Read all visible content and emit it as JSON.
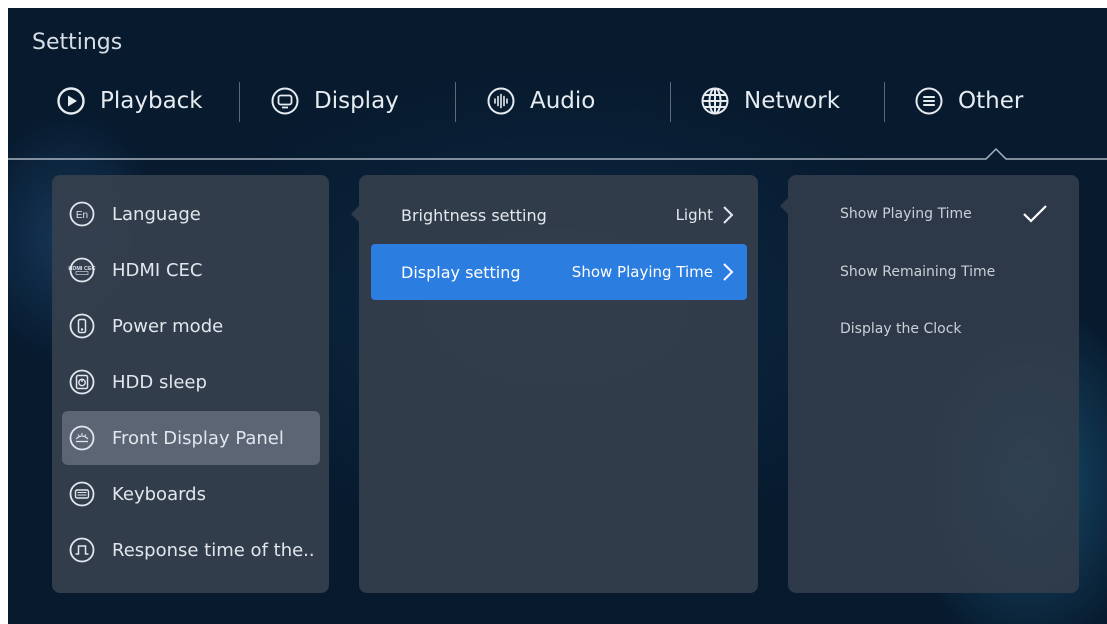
{
  "title": "Settings",
  "tabs": [
    {
      "label": "Playback",
      "icon": "play-circle-icon"
    },
    {
      "label": "Display",
      "icon": "monitor-icon"
    },
    {
      "label": "Audio",
      "icon": "audio-wave-icon"
    },
    {
      "label": "Network",
      "icon": "globe-icon"
    },
    {
      "label": "Other",
      "icon": "menu-circle-icon"
    }
  ],
  "sidebar": {
    "items": [
      {
        "label": "Language",
        "icon": "language-icon",
        "icon_text": "En"
      },
      {
        "label": "HDMI CEC",
        "icon": "hdmi-cec-icon",
        "icon_text": "HDMI CEC"
      },
      {
        "label": "Power mode",
        "icon": "power-mode-icon"
      },
      {
        "label": "HDD sleep",
        "icon": "hdd-sleep-icon"
      },
      {
        "label": "Front Display Panel",
        "icon": "front-display-icon",
        "selected": true
      },
      {
        "label": "Keyboards",
        "icon": "keyboard-icon"
      },
      {
        "label": "Response time of the..",
        "icon": "response-time-icon"
      }
    ]
  },
  "settings": [
    {
      "label": "Brightness setting",
      "value": "Light"
    },
    {
      "label": "Display setting",
      "value": "Show Playing Time",
      "active": true
    }
  ],
  "options": [
    {
      "label": "Show Playing Time",
      "checked": true
    },
    {
      "label": "Show Remaining Time"
    },
    {
      "label": "Display the Clock"
    }
  ],
  "colors": {
    "accent": "#2b7de0",
    "selected_item": "#5b6574",
    "panel": "#36404e"
  }
}
